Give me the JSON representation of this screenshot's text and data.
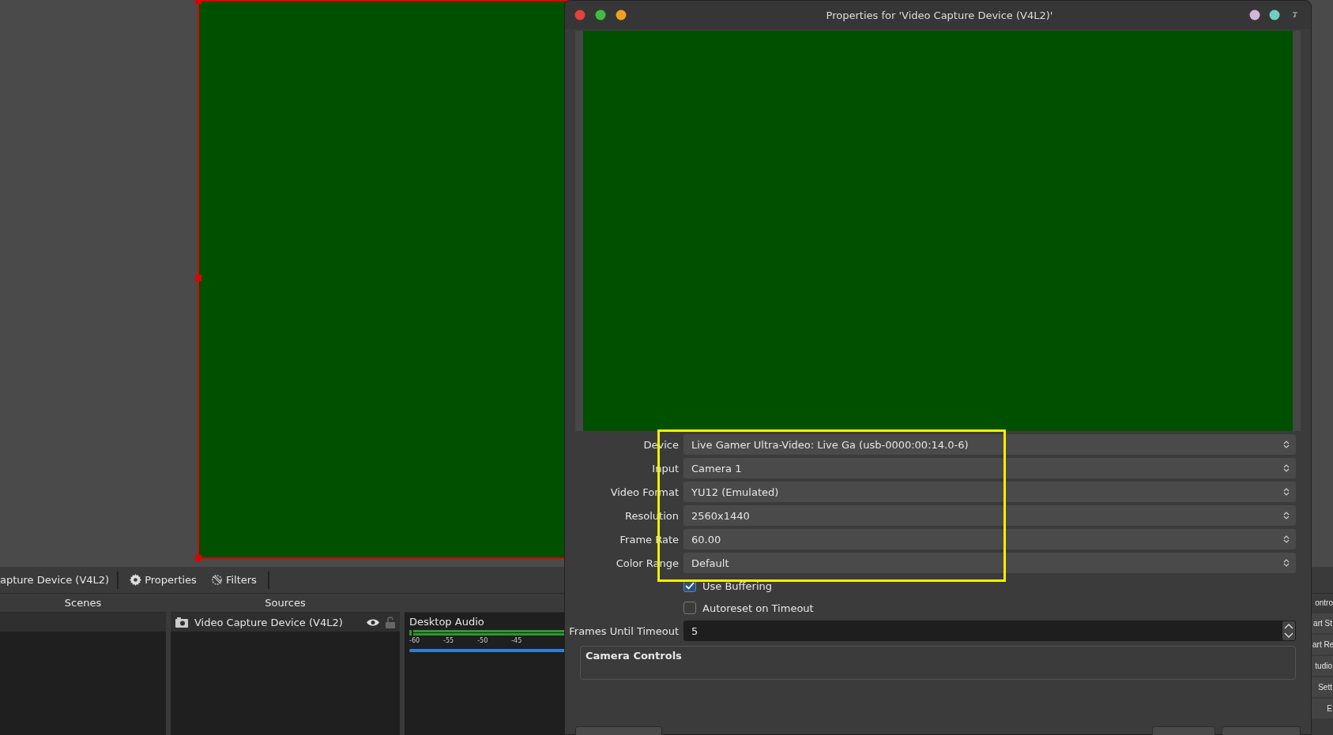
{
  "toolbar": {
    "source_name": "apture Device (V4L2)",
    "buttons": [
      {
        "kind": "properties",
        "label": "Properties"
      },
      {
        "kind": "filters",
        "label": "Filters"
      }
    ]
  },
  "docks": {
    "scenes": {
      "title": "Scenes"
    },
    "sources": {
      "title": "Sources",
      "items": [
        {
          "name": "Video Capture Device (V4L2)",
          "selected": true,
          "visible": true,
          "locked": false
        }
      ]
    },
    "audio_mixer": {
      "channels": [
        {
          "name": "Desktop Audio",
          "ticks": [
            "-60",
            "-55",
            "-50",
            "-45"
          ],
          "level": 1
        }
      ]
    },
    "controls": {
      "title": "ontro",
      "buttons": [
        "art St",
        "art Re",
        "tudio",
        "Sett",
        "E"
      ]
    }
  },
  "dialog": {
    "title": "Properties for 'Video Capture Device (V4L2)'",
    "fields": [
      {
        "label": "Device",
        "value": "Live Gamer Ultra-Video: Live Ga (usb-0000:00:14.0-6)"
      },
      {
        "label": "Input",
        "value": "Camera 1"
      },
      {
        "label": "Video Format",
        "value": "YU12 (Emulated)"
      },
      {
        "label": "Resolution",
        "value": "2560x1440"
      },
      {
        "label": "Frame Rate",
        "value": "60.00"
      },
      {
        "label": "Color Range",
        "value": "Default"
      }
    ],
    "checkboxes": [
      {
        "label": "Use Buffering",
        "checked": true
      },
      {
        "label": "Autoreset on Timeout",
        "checked": false
      }
    ],
    "spin": {
      "label": "Frames Until Timeout",
      "value": "5"
    },
    "group": {
      "title": "Camera Controls"
    }
  }
}
